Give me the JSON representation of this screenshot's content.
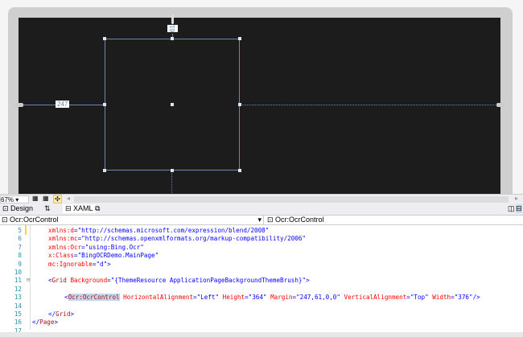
{
  "designer": {
    "margin_left_label": "247",
    "margin_top_label": "61"
  },
  "toolbar": {
    "zoom": "67%"
  },
  "tabs": {
    "design": "Design",
    "swap": "⇅",
    "xaml": "XAML"
  },
  "dropdowns": {
    "left": "Ocr:OcrControl",
    "right": "Ocr:OcrControl"
  },
  "code": {
    "lines": [
      {
        "n": "5",
        "indent": 1,
        "parts": [
          [
            "a",
            "xmlns:d"
          ],
          [
            "p",
            "="
          ],
          [
            "v",
            "\"http://schemas.microsoft.com/expression/blend/2008\""
          ]
        ]
      },
      {
        "n": "6",
        "indent": 1,
        "parts": [
          [
            "a",
            "xmlns:mc"
          ],
          [
            "p",
            "="
          ],
          [
            "v",
            "\"http://schemas.openxmlformats.org/markup-compatibility/2006\""
          ]
        ]
      },
      {
        "n": "7",
        "indent": 1,
        "parts": [
          [
            "a",
            "xmlns:Ocr"
          ],
          [
            "p",
            "="
          ],
          [
            "v",
            "\"using:Bing.Ocr\""
          ]
        ]
      },
      {
        "n": "8",
        "indent": 1,
        "parts": [
          [
            "a",
            "x:Class"
          ],
          [
            "p",
            "="
          ],
          [
            "v",
            "\"BingOCRDemo.MainPage\""
          ]
        ]
      },
      {
        "n": "9",
        "indent": 1,
        "parts": [
          [
            "a",
            "mc:Ignorable"
          ],
          [
            "p",
            "="
          ],
          [
            "v",
            "\"d\""
          ],
          [
            "p",
            ">"
          ]
        ]
      },
      {
        "n": "10",
        "indent": 0,
        "parts": []
      },
      {
        "n": "11",
        "indent": 1,
        "parts": [
          [
            "p",
            "<"
          ],
          [
            "t",
            "Grid"
          ],
          [
            "a",
            " Background"
          ],
          [
            "p",
            "="
          ],
          [
            "v",
            "\"{ThemeResource ApplicationPageBackgroundThemeBrush}\""
          ],
          [
            "p",
            ">"
          ]
        ]
      },
      {
        "n": "12",
        "indent": 0,
        "parts": []
      },
      {
        "n": "13",
        "indent": 2,
        "parts": [
          [
            "p",
            "<"
          ],
          [
            "t",
            "Ocr:OcrControl"
          ],
          [
            "a",
            " HorizontalAlignment"
          ],
          [
            "p",
            "="
          ],
          [
            "v",
            "\"Left\""
          ],
          [
            "a",
            " Height"
          ],
          [
            "p",
            "="
          ],
          [
            "v",
            "\"364\""
          ],
          [
            "a",
            " Margin"
          ],
          [
            "p",
            "="
          ],
          [
            "v",
            "\"247,61,0,0\""
          ],
          [
            "a",
            " VerticalAlignment"
          ],
          [
            "p",
            "="
          ],
          [
            "v",
            "\"Top\""
          ],
          [
            "a",
            " Width"
          ],
          [
            "p",
            "="
          ],
          [
            "v",
            "\"376\""
          ],
          [
            "p",
            "/>"
          ]
        ]
      },
      {
        "n": "14",
        "indent": 0,
        "parts": []
      },
      {
        "n": "15",
        "indent": 1,
        "parts": [
          [
            "p",
            "</"
          ],
          [
            "t",
            "Grid"
          ],
          [
            "p",
            ">"
          ]
        ]
      },
      {
        "n": "16",
        "indent": 0,
        "parts": [
          [
            "p",
            "</"
          ],
          [
            "t",
            "Page"
          ],
          [
            "p",
            ">"
          ]
        ]
      },
      {
        "n": "17",
        "indent": 0,
        "parts": []
      }
    ]
  }
}
